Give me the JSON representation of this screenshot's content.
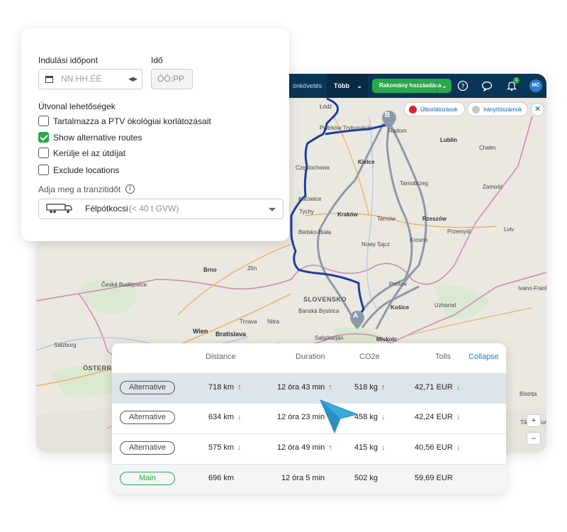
{
  "topbar": {
    "nav_partial": "ónkövetés",
    "more_label": "Több",
    "add_button": "Rakomány hozzáadása",
    "notification_count": "1",
    "avatar_initials": "MC"
  },
  "map": {
    "restrictions_button": "Útkorlátozások",
    "postcodes_button": "Irányítószámok",
    "marker_a": "A",
    "marker_b": "B",
    "zoom_in": "+",
    "zoom_out": "–",
    "labels": {
      "lodz": "Łódź",
      "piotrkow": "Piotrków Trybunalski",
      "radom": "Radom",
      "lublin": "Lublin",
      "chelm": "Chełm",
      "czestochowa": "Częstochowa",
      "kielce": "Kielce",
      "tarnobrzeg": "Tarnobrzeg",
      "zamosc": "Zamość",
      "katowice": "Katowice",
      "krakow": "Kraków",
      "tarnow": "Tarnów",
      "rzeszow": "Rzeszów",
      "przemysl": "Przemyśl",
      "lviv": "Lviv",
      "tychy": "Tychy",
      "bielsko": "Bielsko-Biała",
      "nowy_sacz": "Nowy Sącz",
      "krosno": "Krosno",
      "brno": "Brno",
      "zlin": "Zlín",
      "ceske": "České Budějovice",
      "slovensko": "SLOVENSKO",
      "presov": "Prešov",
      "kosice": "Košice",
      "uzhorod": "Uzhorod",
      "ivano": "Ivano-Frank",
      "wien": "Wien",
      "bratislava": "Bratislava",
      "trnava": "Trnava",
      "nitra": "Nitra",
      "banska": "Banská Bystrica",
      "salgotarjan": "Salgótarján",
      "miskolc": "Miskolc",
      "osterr": "ÖSTERR",
      "salzburg": "Salzburg",
      "bistrita": "Bistrița",
      "targu": "Târgu Mures"
    }
  },
  "options": {
    "departure_label": "Indulási időpont",
    "date_placeholder": "NN.HH.ÉÉ",
    "time_label": "Idő",
    "time_placeholder": "ÓÓ:PP",
    "route_options_title": "Útvonal lehetőségek",
    "checkboxes": [
      {
        "label": "Tartalmazza a PTV ökológiai korlátozásait",
        "checked": false
      },
      {
        "label": "Show alternative routes",
        "checked": true
      },
      {
        "label": "Kerülje el az útdíjat",
        "checked": false
      },
      {
        "label": "Exclude locations",
        "checked": false
      }
    ],
    "transit_label": "Adja meg a tranzitidőt",
    "vehicle_name": "Félpótkocsi",
    "vehicle_desc": "(< 40 t GVW)"
  },
  "routes": {
    "headers": {
      "distance": "Distance",
      "duration": "Duration",
      "co2": "CO2e",
      "tolls": "Tolls"
    },
    "collapse_label": "Collapse",
    "rows": [
      {
        "type": "Alternative",
        "distance": "718 km",
        "distance_arrow": "↑",
        "duration": "12 óra 43 min",
        "duration_arrow": "↑",
        "co2": "518 kg",
        "co2_arrow": "↑",
        "tolls": "42,71 EUR",
        "tolls_arrow": "↓"
      },
      {
        "type": "Alternative",
        "distance": "634 km",
        "distance_arrow": "↓",
        "duration": "12 óra 23 min",
        "duration_arrow": "",
        "co2": "458 kg",
        "co2_arrow": "↓",
        "tolls": "42,24 EUR",
        "tolls_arrow": "↓"
      },
      {
        "type": "Alternative",
        "distance": "575 km",
        "distance_arrow": "↓",
        "duration": "12 óra 49 min",
        "duration_arrow": "↑",
        "co2": "415 kg",
        "co2_arrow": "↓",
        "tolls": "40,56 EUR",
        "tolls_arrow": "↓"
      },
      {
        "type": "Main",
        "distance": "696 km",
        "distance_arrow": "",
        "duration": "12 óra 5 min",
        "duration_arrow": "",
        "co2": "502 kg",
        "co2_arrow": "",
        "tolls": "59,69 EUR",
        "tolls_arrow": ""
      }
    ]
  },
  "colors": {
    "accent_green": "#2aa84a",
    "navy": "#0b3556",
    "route_main": "#1d3f9b",
    "route_alt": "#8e99a8",
    "arrow_up": "#d62b2b",
    "arrow_down": "#2aa84a"
  }
}
